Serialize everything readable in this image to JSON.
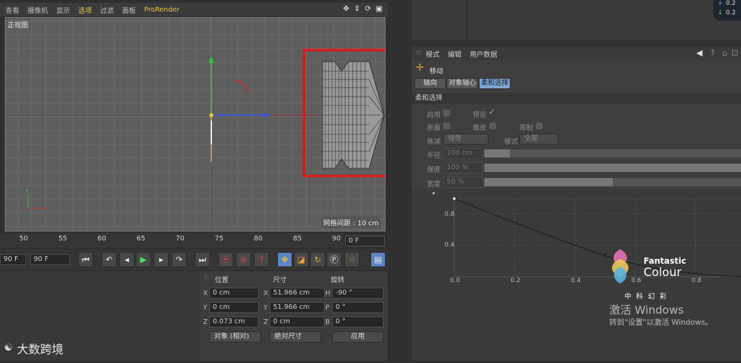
{
  "viewport_menu": {
    "items": [
      "查看",
      "摄像机",
      "显示",
      "选项",
      "过滤",
      "面板",
      "ProRender"
    ],
    "active_index": 3
  },
  "viewport": {
    "label": "正视图",
    "grid_info": "网格间距 : 10 cm"
  },
  "timeline": {
    "ticks": [
      "50",
      "55",
      "60",
      "65",
      "70",
      "75",
      "80",
      "85",
      "90"
    ],
    "frame_field": "0 F",
    "start_field": "90 F",
    "end_field": "90 F"
  },
  "coords": {
    "headers": {
      "position": "位置",
      "size": "尺寸",
      "rotation": "旋转"
    },
    "pos": {
      "x": "0 cm",
      "y": "0 cm",
      "z": "0.073 cm"
    },
    "size": {
      "x": "51.966 cm",
      "y": "51.966 cm",
      "z": "0 cm"
    },
    "rot": {
      "h": "-90 °",
      "p": "0 °",
      "b": "0 °"
    },
    "axes": {
      "x": "X",
      "y": "Y",
      "z": "Z",
      "h": "H",
      "p": "P",
      "b": "B"
    },
    "mode_dropdown": "对象 (相对)",
    "size_dropdown": "绝对尺寸",
    "apply_button": "应用"
  },
  "attributes": {
    "menu": [
      "模式",
      "编辑",
      "用户数据"
    ],
    "tool_title": "移动",
    "tabs": [
      "轴向",
      "对象轴心",
      "柔和选择"
    ],
    "selected_tab": 2,
    "section": "柔和选择",
    "fields": {
      "enable": "启用",
      "preview": "预览",
      "surface": "表面",
      "rubber": "橡皮",
      "limit": "限制",
      "falloff": "衰减",
      "falloff_value": "线性",
      "mode": "模式",
      "mode_value": "全部",
      "radius": "半径",
      "radius_value": "100 cm",
      "strength": "强度",
      "strength_value": "100 %",
      "width": "宽度",
      "width_value": "50 %"
    },
    "strength_fill": 1.0,
    "width_fill": 0.5,
    "radius_fill": 0.1
  },
  "curve": {
    "y_ticks": [
      "0.8",
      "0.4"
    ],
    "x_ticks": [
      "0.0",
      "0.2",
      "0.4",
      "0.6",
      "0.8"
    ]
  },
  "overlay": {
    "windows_line1": "激活 Windows",
    "windows_line2": "转到\"设置\"以激活 Windows。",
    "brand_line1": "Fantastic",
    "brand_line2": "Colour",
    "brand_cn": "中 科 幻 彩",
    "bottom_logo": "大数跨境",
    "top_right_1": "0.2",
    "top_right_2": "0.2"
  },
  "colors": {
    "accent_yellow": "#e8c24a",
    "tab_selected": "#7da6d6",
    "highlight_box": "#d21f1f"
  }
}
